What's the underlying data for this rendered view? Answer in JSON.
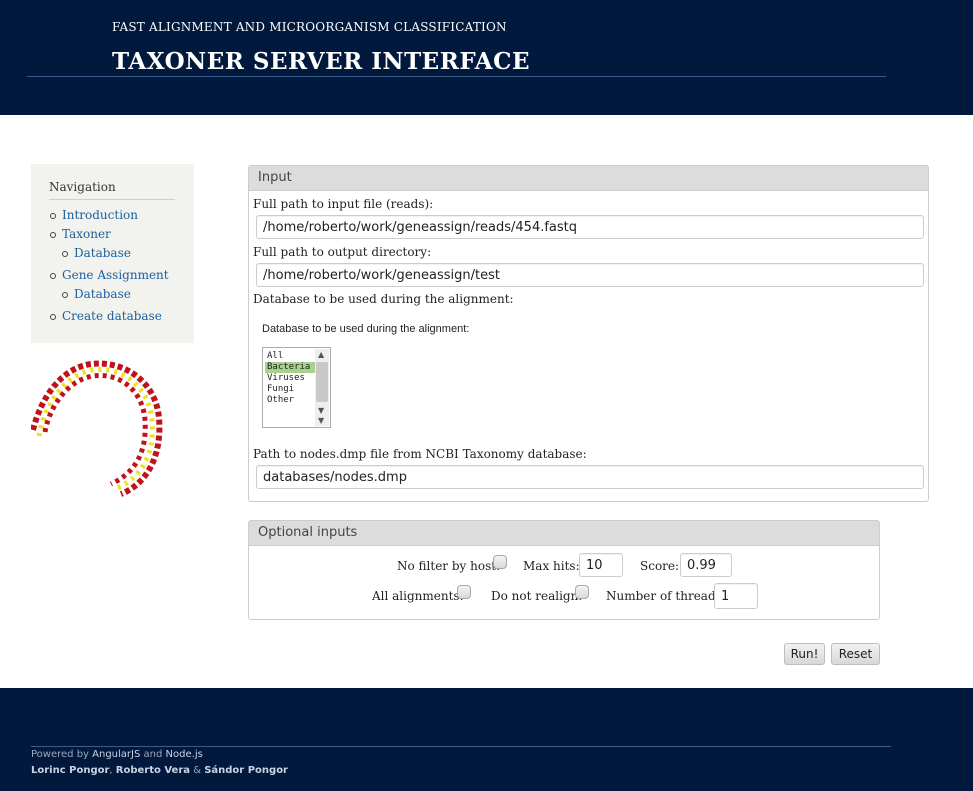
{
  "header": {
    "subtitle": "FAST ALIGNMENT AND MICROORGANISM CLASSIFICATION",
    "title": "TAXONER SERVER INTERFACE"
  },
  "nav": {
    "title": "Navigation",
    "items": [
      {
        "label": "Introduction"
      },
      {
        "label": "Taxoner"
      },
      {
        "label": "Database"
      },
      {
        "label": "Gene Assignment"
      },
      {
        "label": "Database"
      },
      {
        "label": "Create database"
      }
    ]
  },
  "input_panel": {
    "heading": "Input",
    "reads_label": "Full path to input file (reads):",
    "reads_value": "/home/roberto/work/geneassign/reads/454.fastq",
    "output_label": "Full path to output directory:",
    "output_value": "/home/roberto/work/geneassign/test",
    "db_label": "Database to be used during the alignment:",
    "db_sublabel": "Database to be used during the alignment:",
    "db_options": [
      "All",
      "Bacteria",
      "Viruses",
      "Fungi",
      "Other"
    ],
    "db_selected": "Bacteria",
    "nodes_label": "Path to nodes.dmp file from NCBI Taxonomy database:",
    "nodes_value": "databases/nodes.dmp"
  },
  "optional_panel": {
    "heading": "Optional inputs",
    "no_filter_label": "No filter by host:",
    "max_hits_label": "Max hits:",
    "max_hits_value": "10",
    "score_label": "Score:",
    "score_value": "0.99",
    "all_alignments_label": "All alignments:",
    "do_not_realign_label": "Do not realign:",
    "threads_label": "Number of threads:",
    "threads_value": "1"
  },
  "buttons": {
    "run": "Run!",
    "reset": "Reset"
  },
  "footer": {
    "powered_by": "Powered by",
    "angular": "AngularJS",
    "and": "and",
    "node": "Node.js",
    "author1": "Lorinc Pongor",
    "author2": "Roberto Vera",
    "amp": "&",
    "author3": "Sándor Pongor"
  },
  "colors": {
    "header_bg": "#00193d",
    "link": "#1a5f9e",
    "selected_option": "#a9d18e",
    "dna_red": "#c0121a",
    "dna_yellow": "#f0e020"
  }
}
